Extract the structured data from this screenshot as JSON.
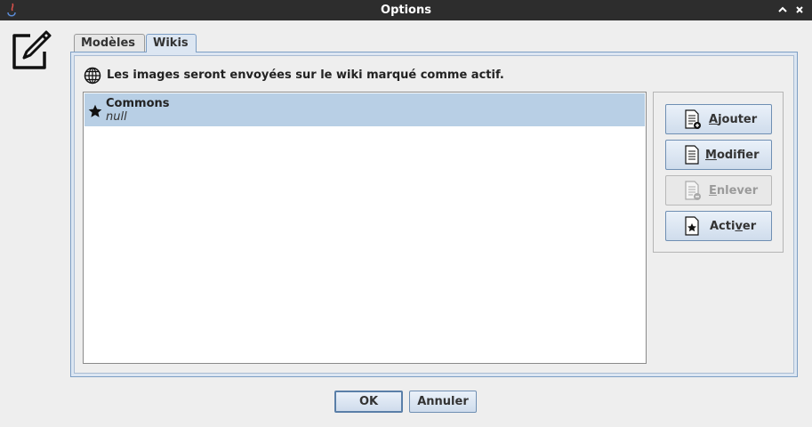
{
  "window": {
    "title": "Options",
    "maximize_icon": "up-arrow-icon",
    "close_icon": "close-icon"
  },
  "tabs": [
    {
      "label": "Modèles",
      "selected": false
    },
    {
      "label": "Wikis",
      "selected": true
    }
  ],
  "wikis_tab": {
    "info_text": "Les images seront envoyées sur le wiki marqué comme actif.",
    "list": [
      {
        "name": "Commons",
        "url": "null",
        "active": true,
        "selected": true
      }
    ],
    "buttons": {
      "ajouter": {
        "pre": "",
        "mnemonic": "A",
        "post": "jouter",
        "enabled": true
      },
      "modifier": {
        "pre": "",
        "mnemonic": "M",
        "post": "odifier",
        "enabled": true
      },
      "enlever": {
        "pre": "",
        "mnemonic": "E",
        "post": "nlever",
        "enabled": false
      },
      "activer": {
        "pre": "Acti",
        "mnemonic": "v",
        "post": "er",
        "enabled": true
      }
    }
  },
  "footer": {
    "ok_label": "OK",
    "cancel_label": "Annuler"
  },
  "colors": {
    "titlebar": "#2d2d2d",
    "selection": "#b8cfe5",
    "button_border": "#6f8fb3"
  }
}
